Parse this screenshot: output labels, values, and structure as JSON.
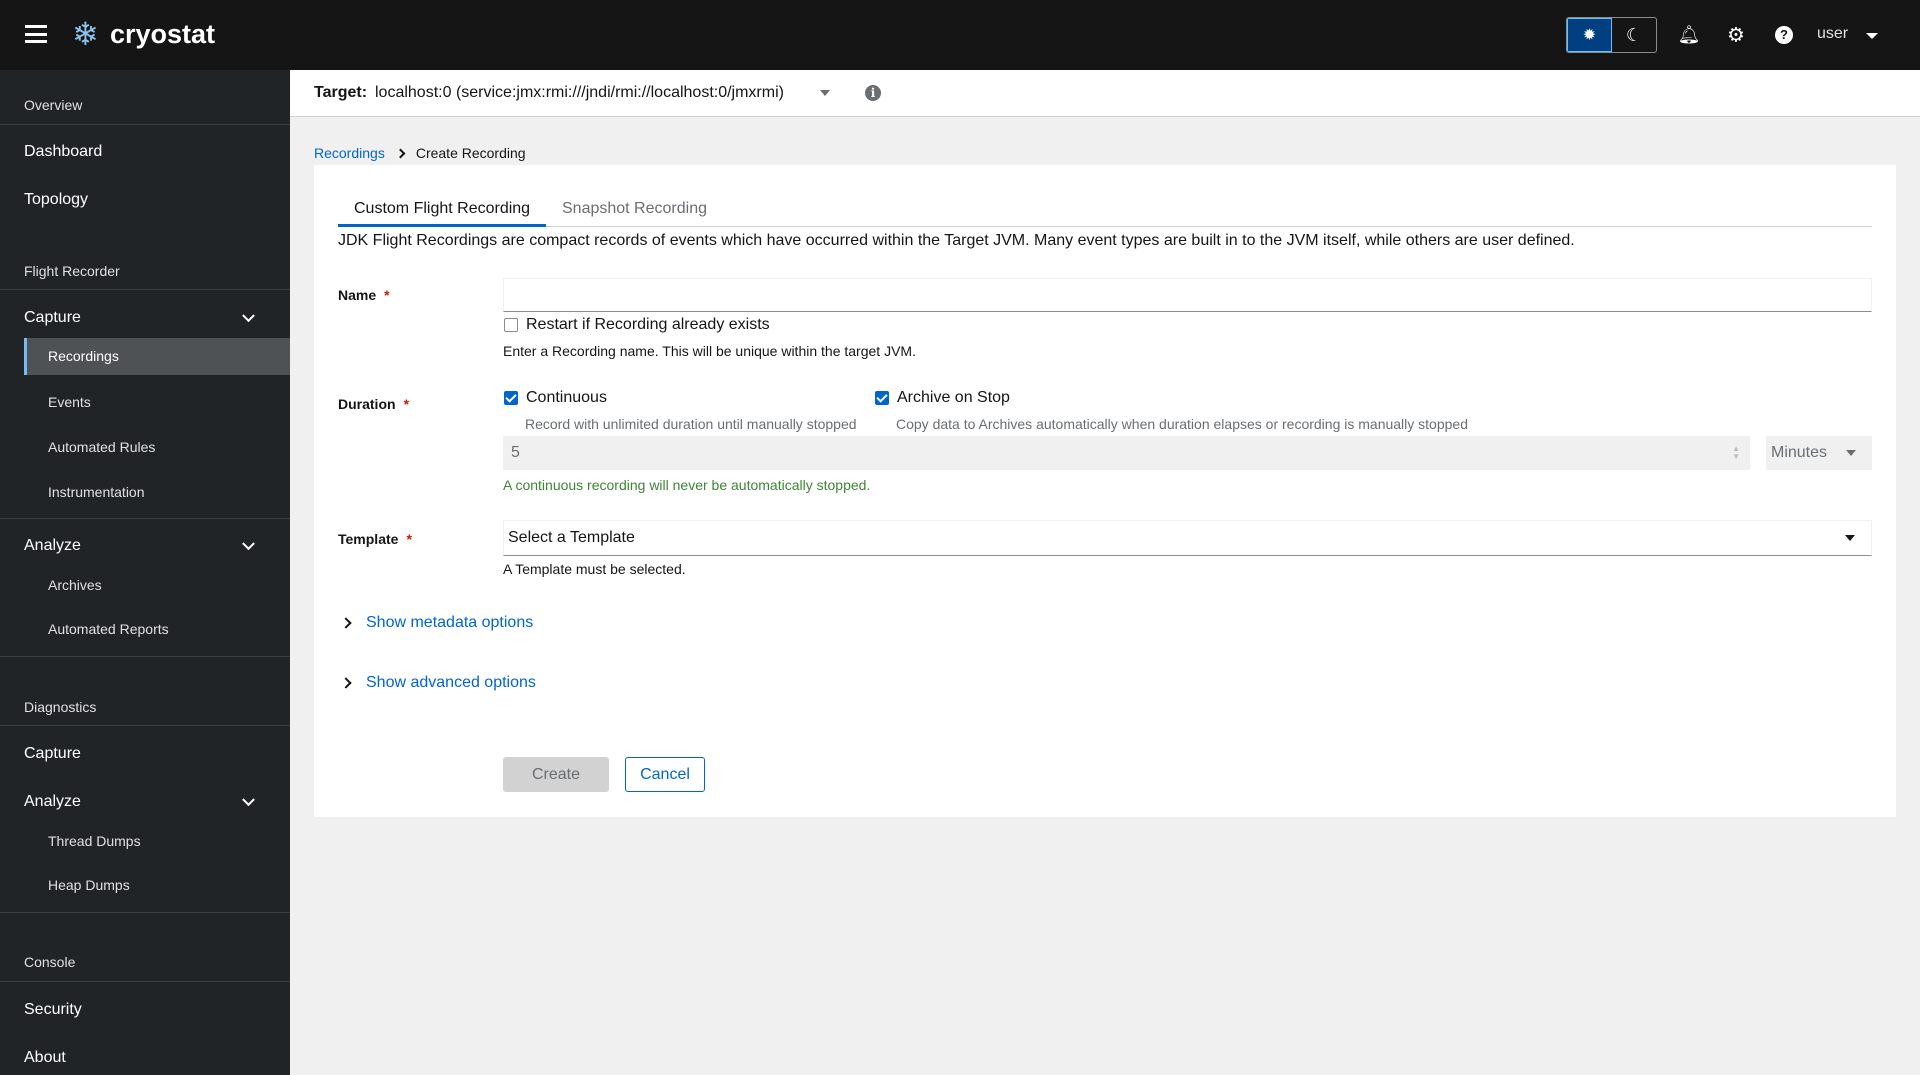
{
  "header": {
    "brand": "cryostat",
    "user": "user",
    "icons": [
      "hamburger-icon",
      "snowflake-logo",
      "sun-icon",
      "moon-icon",
      "bell-icon",
      "gear-icon",
      "help-icon",
      "caret-down-icon"
    ]
  },
  "sidebar": {
    "sections": [
      {
        "label": "Overview",
        "items": [
          "Dashboard",
          "Topology"
        ]
      },
      {
        "label": "Flight Recorder",
        "groups": [
          {
            "label": "Capture",
            "items": [
              "Recordings",
              "Events",
              "Automated Rules",
              "Instrumentation"
            ]
          },
          {
            "label": "Analyze",
            "items": [
              "Archives",
              "Automated Reports"
            ]
          }
        ]
      },
      {
        "label": "Diagnostics",
        "top": [
          "Capture"
        ],
        "groups": [
          {
            "label": "Analyze",
            "items": [
              "Thread Dumps",
              "Heap Dumps"
            ]
          }
        ]
      },
      {
        "label": "Console",
        "items": [
          "Security",
          "About"
        ]
      }
    ],
    "active": "Recordings"
  },
  "target": {
    "label": "Target:",
    "value": "localhost:0 (service:jmx:rmi:///jndi/rmi://localhost:0/jmxrmi)"
  },
  "breadcrumb": {
    "parent": "Recordings",
    "current": "Create Recording"
  },
  "tabs": [
    {
      "label": "Custom Flight Recording",
      "active": true
    },
    {
      "label": "Snapshot Recording",
      "active": false
    }
  ],
  "form": {
    "description": "JDK Flight Recordings are compact records of events which have occurred within the Target JVM. Many event types are built in to the JVM itself, while others are user defined.",
    "name": {
      "label": "Name",
      "required": "*",
      "value": "",
      "restart_label": "Restart if Recording already exists",
      "restart_checked": false,
      "helper": "Enter a Recording name. This will be unique within the target JVM."
    },
    "duration": {
      "label": "Duration",
      "required": "*",
      "continuous_label": "Continuous",
      "continuous_checked": true,
      "continuous_desc": "Record with unlimited duration until manually stopped",
      "archive_label": "Archive on Stop",
      "archive_checked": true,
      "archive_desc": "Copy data to Archives automatically when duration elapses or recording is manually stopped",
      "value": "5",
      "unit": "Minutes",
      "helper": "A continuous recording will never be automatically stopped."
    },
    "template": {
      "label": "Template",
      "required": "*",
      "placeholder": "Select a Template",
      "helper": "A Template must be selected."
    },
    "metadata_toggle": "Show metadata options",
    "advanced_toggle": "Show advanced options",
    "create": "Create",
    "cancel": "Cancel"
  },
  "colors": {
    "accent": "#0066cc",
    "success": "#3e8635",
    "header": "#151515",
    "sidebar": "#212427"
  }
}
